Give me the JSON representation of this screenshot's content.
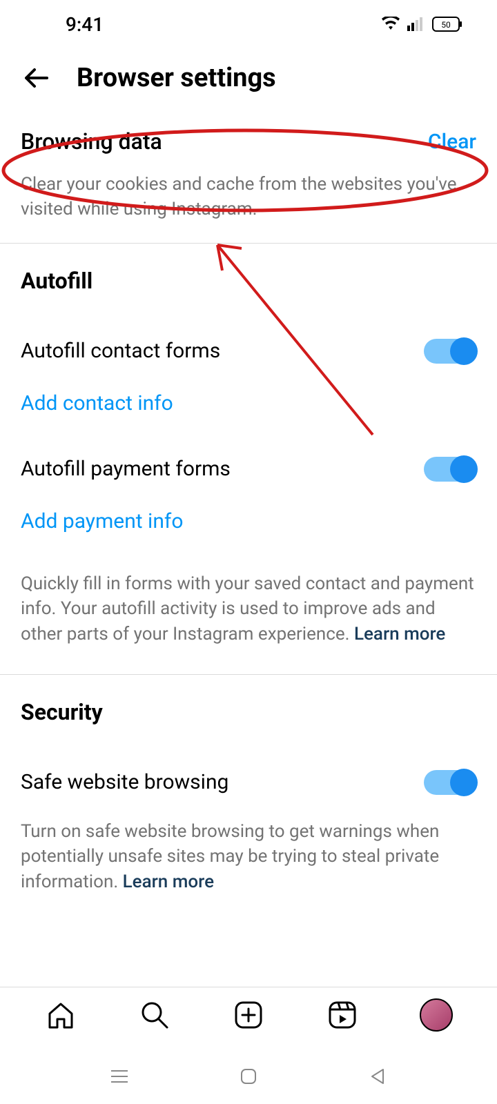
{
  "status": {
    "time": "9:41",
    "battery": "50"
  },
  "header": {
    "title": "Browser settings"
  },
  "browsing": {
    "title": "Browsing data",
    "clear_label": "Clear",
    "description": "Clear your cookies and cache from the websites you've visited while using Instagram."
  },
  "autofill": {
    "title": "Autofill",
    "contact_forms_label": "Autofill contact forms",
    "add_contact_label": "Add contact info",
    "payment_forms_label": "Autofill payment forms",
    "add_payment_label": "Add payment info",
    "description_main": "Quickly fill in forms with your saved contact and payment info. Your autofill activity is used to improve ads and other parts of your Instagram experience. ",
    "learn_more": "Learn more"
  },
  "security": {
    "title": "Security",
    "safe_browsing_label": "Safe website browsing",
    "description_main": "Turn on safe website browsing to get warnings when potentially unsafe sites may be trying to steal private information. ",
    "learn_more": "Learn more"
  }
}
